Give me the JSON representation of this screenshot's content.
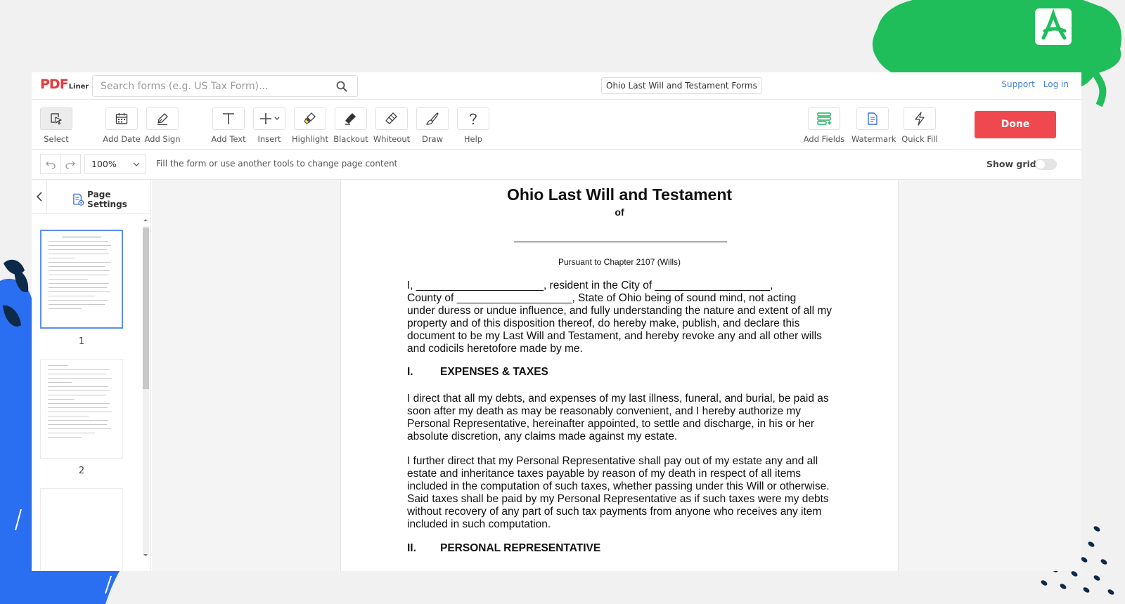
{
  "app": {
    "logo_main": "PDF",
    "logo_sub": "Liner",
    "search_placeholder": "Search forms (e.g. US Tax Form)...",
    "document_title": "Ohio Last Will and Testament Forms",
    "links": {
      "support": "Support",
      "login": "Log in"
    }
  },
  "toolbar": {
    "tools": [
      {
        "label": "Select"
      },
      {
        "label": "Add Date"
      },
      {
        "label": "Add Sign"
      },
      {
        "label": "Add Text"
      },
      {
        "label": "Insert"
      },
      {
        "label": "Highlight"
      },
      {
        "label": "Blackout"
      },
      {
        "label": "Whiteout"
      },
      {
        "label": "Draw"
      },
      {
        "label": "Help"
      },
      {
        "label": "Add Fields"
      },
      {
        "label": "Watermark"
      },
      {
        "label": "Quick Fill"
      }
    ],
    "done_label": "Done"
  },
  "subbar": {
    "zoom": "100%",
    "hint": "Fill the form or use another tools to change page content",
    "show_grid_label": "Show grid",
    "show_grid": false
  },
  "sidebar": {
    "page_settings_label": "Page Settings",
    "pages": [
      "1",
      "2"
    ]
  },
  "document": {
    "title": "Ohio Last Will and Testament",
    "of": "of",
    "pursuant": "Pursuant to Chapter 2107 (Wills)",
    "intro": "I, _____________________, resident in the City of ___________________,\nCounty of ___________________, State of Ohio being of sound mind, not acting\nunder duress or undue influence, and fully understanding the nature and extent of all my\nproperty and of this disposition thereof, do hereby make, publish, and declare this\ndocument to be my Last Will and Testament, and hereby revoke any and all other wills\nand codicils heretofore made by me.",
    "section1_num": "I.",
    "section1_title": "EXPENSES & TAXES",
    "para1": "I direct that all my debts, and expenses of my last illness, funeral, and burial, be paid as\nsoon after my death as may be reasonably convenient, and I hereby authorize my\nPersonal Representative, hereinafter appointed, to settle and discharge, in his or her\nabsolute discretion, any claims made against my estate.",
    "para2": "I further direct that my Personal Representative shall pay out of my estate any and all\nestate and inheritance taxes payable by reason of my death in respect of all items\nincluded in the computation of such taxes, whether passing under this Will or otherwise.\nSaid taxes shall be paid by my Personal Representative as if such taxes were my debts\nwithout recovery of any part of such tax payments from anyone who receives any item\nincluded in such computation.",
    "section2_num": "II.",
    "section2_title": "PERSONAL REPRESENTATIVE"
  },
  "colors": {
    "accent_done": "#f0484f",
    "link": "#3d7fd9",
    "brand_green": "#1fbe5a",
    "brand_blue": "#2a6ef2",
    "dark_navy": "#0e2a4a"
  }
}
